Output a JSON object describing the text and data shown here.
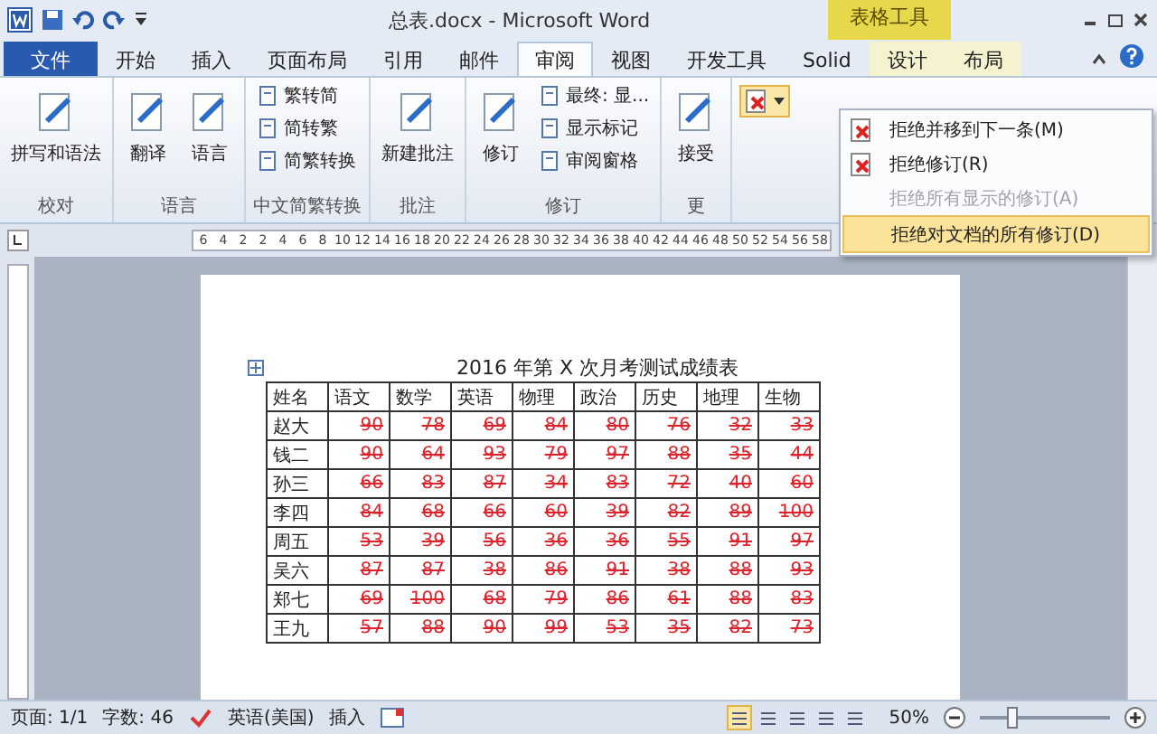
{
  "window": {
    "title": "总表.docx  -  Microsoft Word",
    "context_tab_group": "表格工具"
  },
  "tabs": [
    {
      "label": "文件",
      "kind": "file",
      "selected": false
    },
    {
      "label": "开始",
      "kind": "normal",
      "selected": false
    },
    {
      "label": "插入",
      "kind": "normal",
      "selected": false
    },
    {
      "label": "页面布局",
      "kind": "normal",
      "selected": false
    },
    {
      "label": "引用",
      "kind": "normal",
      "selected": false
    },
    {
      "label": "邮件",
      "kind": "normal",
      "selected": false
    },
    {
      "label": "审阅",
      "kind": "normal",
      "selected": true
    },
    {
      "label": "视图",
      "kind": "normal",
      "selected": false
    },
    {
      "label": "开发工具",
      "kind": "normal",
      "selected": false
    },
    {
      "label": "Solid",
      "kind": "normal",
      "selected": false
    },
    {
      "label": "设计",
      "kind": "context",
      "selected": false
    },
    {
      "label": "布局",
      "kind": "context",
      "selected": false
    }
  ],
  "ribbon_groups": [
    {
      "label": "校对",
      "large": [
        "拼写和语法"
      ]
    },
    {
      "label": "语言",
      "large": [
        "翻译",
        "语言"
      ]
    },
    {
      "label": "中文简繁转换",
      "small": [
        "繁转简",
        "简转繁",
        "简繁转换"
      ]
    },
    {
      "label": "批注",
      "large": [
        "新建批注"
      ]
    },
    {
      "label": "修订",
      "large": [
        "修订"
      ],
      "small": [
        "最终: 显...",
        "显示标记",
        "审阅窗格"
      ]
    },
    {
      "label": "更",
      "large": [
        "接受"
      ]
    }
  ],
  "reject_menu": [
    {
      "label": "拒绝并移到下一条(M)",
      "disabled": false,
      "selected": false
    },
    {
      "label": "拒绝修订(R)",
      "disabled": false,
      "selected": false
    },
    {
      "label": "拒绝所有显示的修订(A)",
      "disabled": true,
      "selected": false
    },
    {
      "label": "拒绝对文档的所有修订(D)",
      "disabled": false,
      "selected": true
    }
  ],
  "ruler": [
    "6",
    "4",
    "2",
    "2",
    "4",
    "6",
    "8",
    "10",
    "12",
    "14",
    "16",
    "18",
    "20",
    "22",
    "24",
    "26",
    "28",
    "30",
    "32",
    "34",
    "36",
    "38",
    "40",
    "42",
    "44",
    "46",
    "48",
    "50",
    "52",
    "54",
    "56",
    "58"
  ],
  "document": {
    "title": "2016 年第 X 次月考测试成绩表",
    "table": {
      "columns": [
        "姓名",
        "语文",
        "数学",
        "英语",
        "物理",
        "政治",
        "历史",
        "地理",
        "生物"
      ],
      "rows": [
        {
          "name": "赵大",
          "deleted": true,
          "scores": [
            "90",
            "78",
            "69",
            "84",
            "80",
            "76",
            "32",
            "33"
          ]
        },
        {
          "name": "钱二",
          "deleted": true,
          "scores": [
            "90",
            "64",
            "93",
            "79",
            "97",
            "88",
            "35",
            "44"
          ]
        },
        {
          "name": "孙三",
          "deleted": true,
          "scores": [
            "66",
            "83",
            "87",
            "34",
            "83",
            "72",
            "40",
            "60"
          ]
        },
        {
          "name": "李四",
          "deleted": true,
          "scores": [
            "84",
            "68",
            "66",
            "60",
            "39",
            "82",
            "89",
            "100"
          ]
        },
        {
          "name": "周五",
          "deleted": true,
          "scores": [
            "53",
            "39",
            "56",
            "36",
            "36",
            "55",
            "91",
            "97"
          ]
        },
        {
          "name": "吴六",
          "deleted": true,
          "scores": [
            "87",
            "87",
            "38",
            "86",
            "91",
            "38",
            "88",
            "93"
          ]
        },
        {
          "name": "郑七",
          "deleted": true,
          "scores": [
            "69",
            "100",
            "68",
            "79",
            "86",
            "61",
            "88",
            "83"
          ]
        },
        {
          "name": "王九",
          "deleted": true,
          "scores": [
            "57",
            "88",
            "90",
            "99",
            "53",
            "35",
            "82",
            "73"
          ]
        }
      ]
    }
  },
  "status_bar": {
    "page": "页面: 1/1",
    "words": "字数: 46",
    "language": "英语(美国)",
    "mode": "插入",
    "zoom": "50%",
    "views": [
      {
        "selected": true
      },
      {
        "selected": false
      },
      {
        "selected": false
      },
      {
        "selected": false
      },
      {
        "selected": false
      }
    ],
    "zoom_slider": {
      "level": 0.25
    }
  }
}
